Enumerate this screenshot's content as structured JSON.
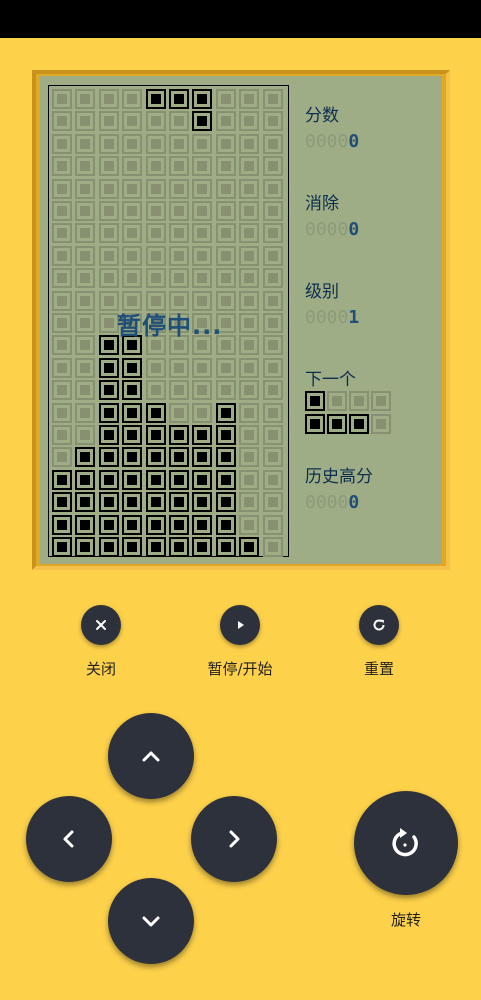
{
  "screen": {
    "paused_text": "暂停中...",
    "score_label": "分数",
    "score_dim": "0000",
    "score_value": "0",
    "lines_label": "消除",
    "lines_dim": "0000",
    "lines_value": "0",
    "level_label": "级别",
    "level_dim": "0000",
    "level_value": "1",
    "next_label": "下一个",
    "high_label": "历史高分",
    "high_dim": "0000",
    "high_value": "0"
  },
  "board": {
    "cols": 10,
    "rows": 20,
    "cells": [
      "0000111000",
      "0000001000",
      "0000000000",
      "0000000000",
      "0000000000",
      "0000000000",
      "0000000000",
      "0000000000",
      "0000000000",
      "0000000000",
      "0000000000",
      "0011000000",
      "0011000000",
      "0011000000",
      "0011100100",
      "0011111100",
      "0111111100",
      "1111111100",
      "1111111100",
      "1111111100",
      "1111111110"
    ]
  },
  "next_piece": [
    "1000",
    "1110"
  ],
  "controls": {
    "close_label": "关闭",
    "pause_label": "暂停/开始",
    "reset_label": "重置",
    "rotate_label": "旋转"
  },
  "icons": {
    "close": "close-icon",
    "play": "play-icon",
    "reset": "refresh-icon",
    "up": "chevron-up-icon",
    "left": "chevron-left-icon",
    "right": "chevron-right-icon",
    "down": "chevron-down-icon",
    "rotate": "rotate-icon"
  }
}
